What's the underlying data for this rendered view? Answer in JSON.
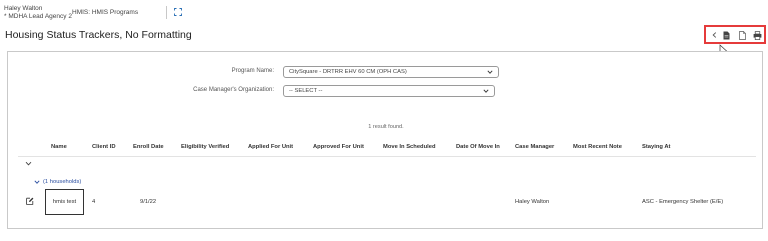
{
  "header": {
    "user_name": "Haley Walton",
    "agency": "* MDHA Lead Agency 2",
    "hmis_label": "HMIS: HMIS Programs",
    "page_title": "Housing Status Trackers, No Formatting"
  },
  "actions": {
    "icons": [
      "chevron-left-icon",
      "document-icon",
      "document-outline-icon",
      "print-icon"
    ],
    "accent_color": "#e53b3b"
  },
  "filters": {
    "program_label": "Program Name:",
    "program_value": "CitySquare - DRTRR EHV 60 CM (OPH CAS)",
    "org_label": "Case Manager's Organization:",
    "org_value": "-- SELECT --"
  },
  "results": {
    "count_text": "1 result found.",
    "columns": [
      "Name",
      "Client ID",
      "Enroll Date",
      "Eligibility Verified",
      "Applied For Unit",
      "Approved For Unit",
      "Move In Scheduled",
      "Date Of Move In",
      "Case Manager",
      "Most Recent Note",
      "Staying At"
    ],
    "group_label": "(1 households)",
    "rows": [
      {
        "name": "hmis test",
        "client_id": "4",
        "enroll_date": "9/1/22",
        "case_manager": "Haley Walton",
        "staying_at": "ASC - Emergency Shelter (E/E)"
      }
    ]
  }
}
